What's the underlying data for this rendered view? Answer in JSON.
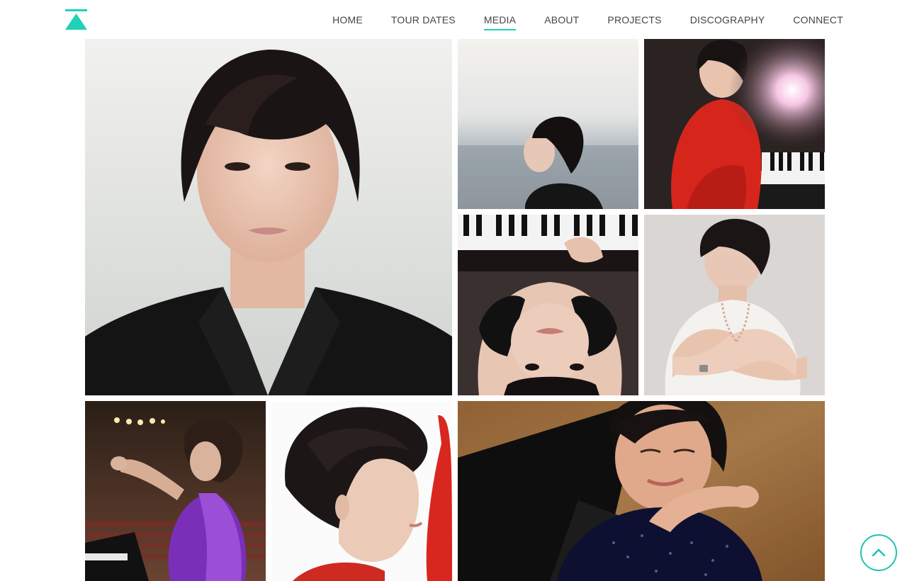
{
  "brand": {
    "logo_icon": "teal-arrow-up-logo-icon",
    "accent_color": "#1fd1b8"
  },
  "nav": {
    "items": [
      {
        "label": "HOME",
        "active": false
      },
      {
        "label": "TOUR DATES",
        "active": false
      },
      {
        "label": "MEDIA",
        "active": true
      },
      {
        "label": "ABOUT",
        "active": false
      },
      {
        "label": "PROJECTS",
        "active": false
      },
      {
        "label": "DISCOGRAPHY",
        "active": false
      },
      {
        "label": "CONNECT",
        "active": false
      }
    ]
  },
  "gallery": {
    "photos": [
      {
        "subject": "portrait-black-jacket"
      },
      {
        "subject": "profile-eyes-closed-sky"
      },
      {
        "subject": "red-dress-at-piano"
      },
      {
        "subject": "upside-down-on-keyboard"
      },
      {
        "subject": "hugging-self-white-top"
      },
      {
        "subject": "purple-dress-performing"
      },
      {
        "subject": "profile-close-up-red"
      },
      {
        "subject": "playing-eyes-closed-sparkle-dress"
      }
    ]
  },
  "scroll_top": {
    "icon": "chevron-up-icon"
  }
}
